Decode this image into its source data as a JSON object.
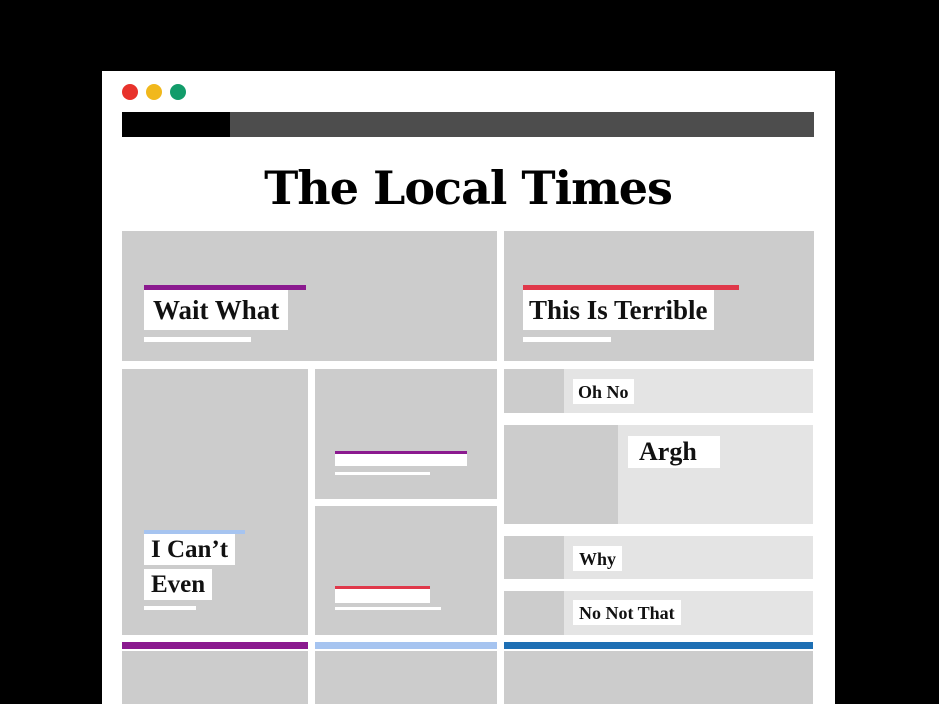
{
  "window": {
    "controls": {
      "close_color": "#e8322b",
      "minimize_color": "#f1b81c",
      "maximize_color": "#129c6a"
    }
  },
  "masthead": {
    "title": "The Local Times"
  },
  "stories": {
    "top_left": {
      "headline": "Wait What",
      "accent": "#8b1a8f"
    },
    "top_right": {
      "headline": "This Is Terrible",
      "accent": "#e0384a"
    },
    "feature": {
      "headline_line1": "I Can’t",
      "headline_line2": "Even",
      "accent": "#a6c4f0"
    },
    "mid_top": {
      "accent": "#8b1a8f"
    },
    "mid_bottom": {
      "accent": "#e0384a"
    },
    "list": [
      {
        "headline": "Oh No"
      },
      {
        "headline": "Argh"
      },
      {
        "headline": "Why"
      },
      {
        "headline": "No Not That"
      }
    ]
  },
  "footer_bars": {
    "left": "#8b1a8f",
    "middle": "#a6c4f0",
    "right": "#1e6fb4"
  }
}
